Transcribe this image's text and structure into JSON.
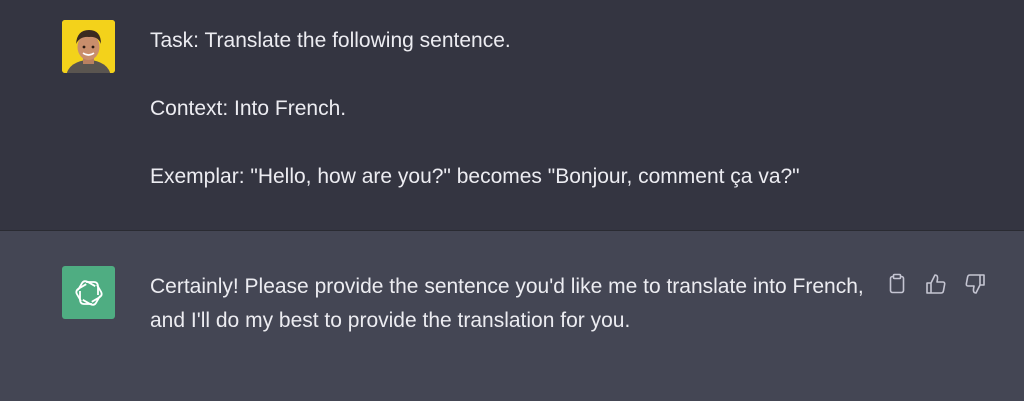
{
  "conversation": {
    "user_message": {
      "avatar_icon": "user-avatar",
      "lines": [
        "Task: Translate the following sentence.",
        "Context: Into French.",
        "Exemplar: \"Hello, how are you?\" becomes \"Bonjour, comment ça va?\""
      ]
    },
    "assistant_message": {
      "avatar_icon": "openai-logo-icon",
      "text": "Certainly! Please provide the sentence you'd like me to translate into French, and I'll do my best to provide the translation for you.",
      "actions": [
        {
          "name": "copy-icon"
        },
        {
          "name": "thumbs-up-icon"
        },
        {
          "name": "thumbs-down-icon"
        }
      ]
    }
  },
  "colors": {
    "user_bg": "#343541",
    "assistant_bg": "#444654",
    "text": "#ececf1",
    "assistant_avatar": "#4fad82",
    "user_avatar": "#f3d21b"
  }
}
